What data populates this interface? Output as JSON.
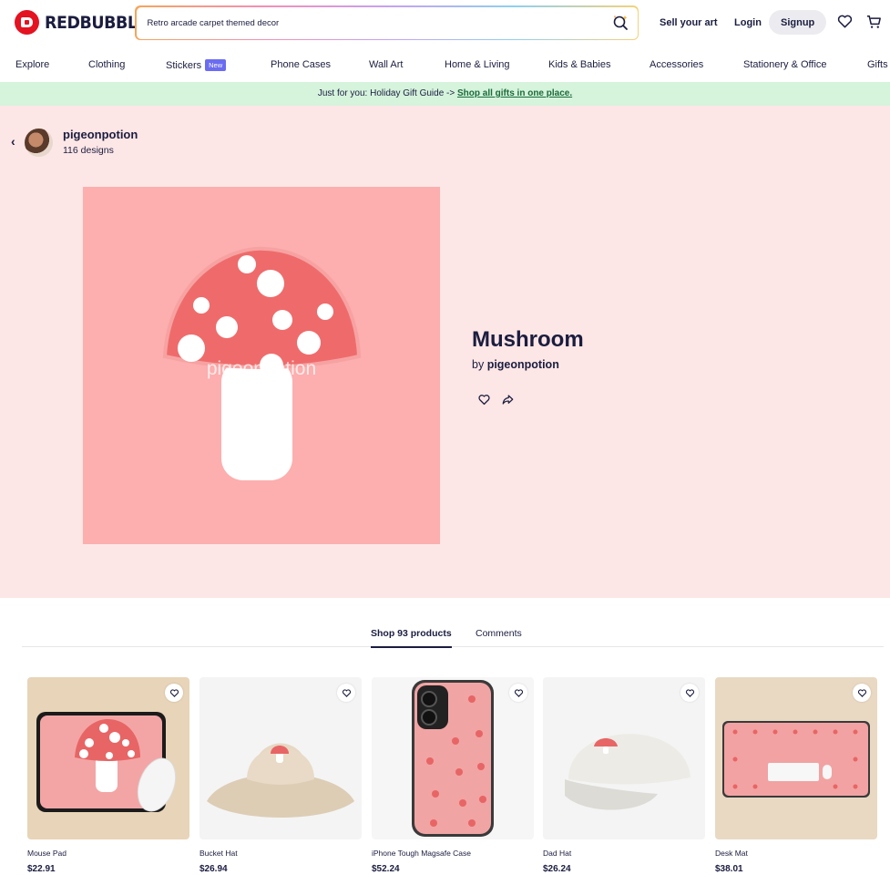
{
  "header": {
    "logo_text": "REDBUBBLE",
    "search_value": "Retro arcade carpet themed decor",
    "sell_label": "Sell your art",
    "login_label": "Login",
    "signup_label": "Signup",
    "icons": [
      "search-icon",
      "heart-icon",
      "cart-icon"
    ]
  },
  "categories": [
    {
      "label": "Explore"
    },
    {
      "label": "Clothing"
    },
    {
      "label": "Stickers",
      "badge": "New"
    },
    {
      "label": "Phone Cases"
    },
    {
      "label": "Wall Art"
    },
    {
      "label": "Home & Living"
    },
    {
      "label": "Kids & Babies"
    },
    {
      "label": "Accessories"
    },
    {
      "label": "Stationery & Office"
    },
    {
      "label": "Gifts"
    }
  ],
  "banner": {
    "text": "Just for you: Holiday Gift Guide -> ",
    "link": "Shop all gifts in one place."
  },
  "artist": {
    "name": "pigeonpotion",
    "designs": "116 designs"
  },
  "artwork": {
    "watermark": "pigeonpotion",
    "title": "Mushroom",
    "by_prefix": "by ",
    "by_name": "pigeonpotion",
    "colors": {
      "bg": "#fdaeae",
      "cap": "#ef6b6b",
      "stem": "#ffffff"
    }
  },
  "tabs": {
    "shop": "Shop 93 products",
    "comments": "Comments"
  },
  "products": [
    {
      "name": "Mouse Pad",
      "price": "$22.91"
    },
    {
      "name": "Bucket Hat",
      "price": "$26.94"
    },
    {
      "name": "iPhone Tough Magsafe Case",
      "price": "$52.24"
    },
    {
      "name": "Dad Hat",
      "price": "$26.24"
    },
    {
      "name": "Desk Mat",
      "price": "$38.01"
    }
  ]
}
